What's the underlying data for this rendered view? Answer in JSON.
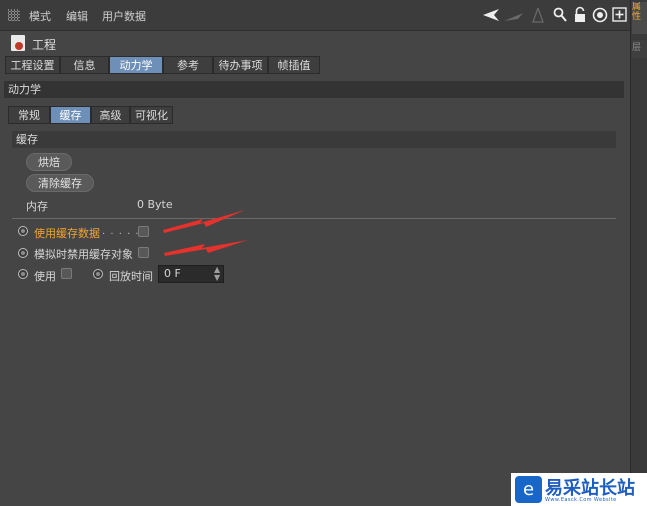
{
  "menubar": {
    "items": [
      {
        "label": "模式"
      },
      {
        "label": "编辑"
      },
      {
        "label": "用户数据"
      }
    ],
    "icons": [
      "back-arrow-icon",
      "forward-arrow-icon",
      "up-arrow-icon",
      "search-icon",
      "lock-icon",
      "target-icon",
      "new-panel-icon"
    ]
  },
  "right_panel": {
    "tab1": "属性",
    "tab2": "层"
  },
  "header": {
    "title": "工程"
  },
  "tabs": [
    {
      "label": "工程设置",
      "active": false
    },
    {
      "label": "信息",
      "active": false
    },
    {
      "label": "动力学",
      "active": true
    },
    {
      "label": "参考",
      "active": false
    },
    {
      "label": "待办事项",
      "active": false
    },
    {
      "label": "帧插值",
      "active": false
    }
  ],
  "section": {
    "title": "动力学"
  },
  "subtabs": [
    {
      "label": "常规",
      "active": false
    },
    {
      "label": "缓存",
      "active": true
    },
    {
      "label": "高级",
      "active": false
    },
    {
      "label": "可视化",
      "active": false
    }
  ],
  "cache": {
    "group_title": "缓存",
    "bake_button": "烘焙",
    "clear_button": "清除缓存",
    "memory_label": "内存",
    "memory_value": "0 Byte",
    "use_cache_label": "使用缓存数据",
    "use_cache_dots": ". . . . .",
    "disable_cached_label": "模拟时禁用缓存对象",
    "enable_label": "使用",
    "playback_label": "回放时间",
    "playback_value": "0 F"
  },
  "colors": {
    "accent_tab": "#6d8fb8",
    "highlight_label": "#f0a534",
    "arrow": "#e5322d"
  },
  "watermark": {
    "name": "易采站长站",
    "url": "Www.Easck.Com  Website"
  }
}
